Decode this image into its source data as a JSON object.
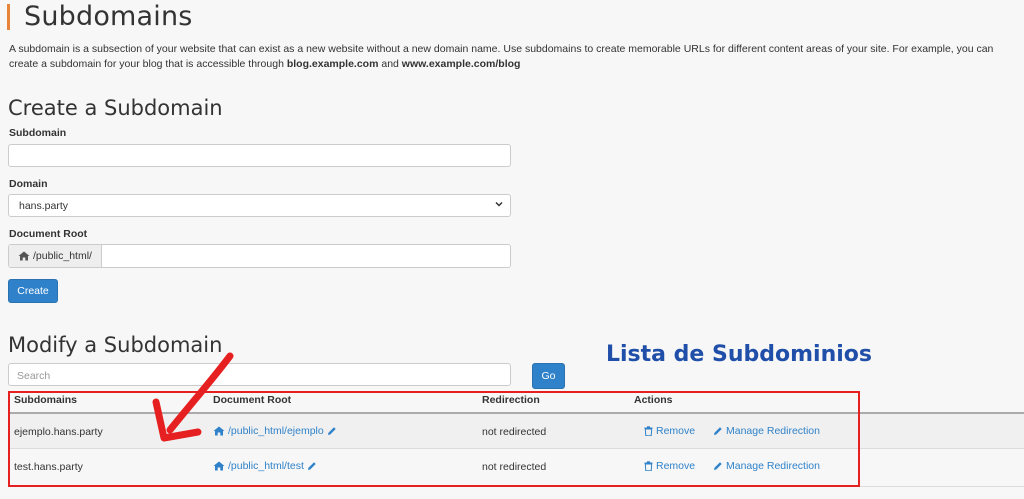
{
  "page": {
    "title": "Subdomains",
    "description_main": "A subdomain is a subsection of your website that can exist as a new website without a new domain name. Use subdomains to create memorable URLs for different content areas of your site. For example, you can create a subdomain for your blog that is accessible through ",
    "description_bold1": "blog.example.com",
    "description_and": " and ",
    "description_bold2": "www.example.com/blog"
  },
  "create": {
    "heading": "Create a Subdomain",
    "subdomain_label": "Subdomain",
    "subdomain_value": "",
    "domain_label": "Domain",
    "domain_value": "hans.party",
    "docroot_label": "Document Root",
    "docroot_prefix": "/public_html/",
    "docroot_value": "",
    "create_button": "Create"
  },
  "modify": {
    "heading": "Modify a Subdomain",
    "search_placeholder": "Search",
    "go_button": "Go",
    "columns": [
      "Subdomains",
      "Document Root",
      "Redirection",
      "Actions"
    ],
    "rows": [
      {
        "subdomain": "ejemplo.hans.party",
        "docroot": "/public_html/ejemplo",
        "redirection": "not redirected",
        "remove": "Remove",
        "manage": "Manage Redirection"
      },
      {
        "subdomain": "test.hans.party",
        "docroot": "/public_html/test",
        "redirection": "not redirected",
        "remove": "Remove",
        "manage": "Manage Redirection"
      }
    ]
  },
  "annotation": {
    "label": "Lista de Subdominios",
    "label_color": "#1f4fa8",
    "highlight_color": "#e62020"
  },
  "colors": {
    "accent": "#e8833a",
    "primary": "#2f82c9"
  }
}
